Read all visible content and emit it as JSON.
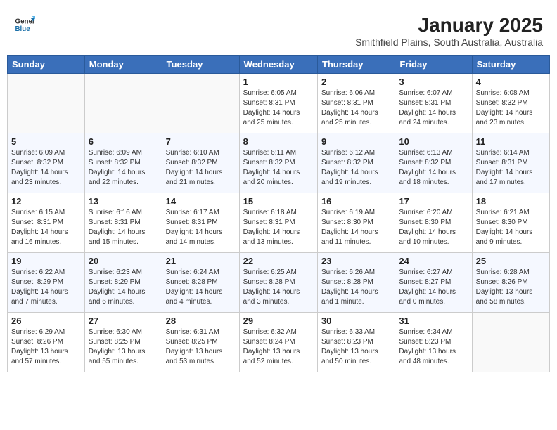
{
  "header": {
    "logo_general": "General",
    "logo_blue": "Blue",
    "title": "January 2025",
    "subtitle": "Smithfield Plains, South Australia, Australia"
  },
  "calendar": {
    "days_of_week": [
      "Sunday",
      "Monday",
      "Tuesday",
      "Wednesday",
      "Thursday",
      "Friday",
      "Saturday"
    ],
    "weeks": [
      [
        {
          "day": "",
          "info": ""
        },
        {
          "day": "",
          "info": ""
        },
        {
          "day": "",
          "info": ""
        },
        {
          "day": "1",
          "info": "Sunrise: 6:05 AM\nSunset: 8:31 PM\nDaylight: 14 hours\nand 25 minutes."
        },
        {
          "day": "2",
          "info": "Sunrise: 6:06 AM\nSunset: 8:31 PM\nDaylight: 14 hours\nand 25 minutes."
        },
        {
          "day": "3",
          "info": "Sunrise: 6:07 AM\nSunset: 8:31 PM\nDaylight: 14 hours\nand 24 minutes."
        },
        {
          "day": "4",
          "info": "Sunrise: 6:08 AM\nSunset: 8:32 PM\nDaylight: 14 hours\nand 23 minutes."
        }
      ],
      [
        {
          "day": "5",
          "info": "Sunrise: 6:09 AM\nSunset: 8:32 PM\nDaylight: 14 hours\nand 23 minutes."
        },
        {
          "day": "6",
          "info": "Sunrise: 6:09 AM\nSunset: 8:32 PM\nDaylight: 14 hours\nand 22 minutes."
        },
        {
          "day": "7",
          "info": "Sunrise: 6:10 AM\nSunset: 8:32 PM\nDaylight: 14 hours\nand 21 minutes."
        },
        {
          "day": "8",
          "info": "Sunrise: 6:11 AM\nSunset: 8:32 PM\nDaylight: 14 hours\nand 20 minutes."
        },
        {
          "day": "9",
          "info": "Sunrise: 6:12 AM\nSunset: 8:32 PM\nDaylight: 14 hours\nand 19 minutes."
        },
        {
          "day": "10",
          "info": "Sunrise: 6:13 AM\nSunset: 8:32 PM\nDaylight: 14 hours\nand 18 minutes."
        },
        {
          "day": "11",
          "info": "Sunrise: 6:14 AM\nSunset: 8:31 PM\nDaylight: 14 hours\nand 17 minutes."
        }
      ],
      [
        {
          "day": "12",
          "info": "Sunrise: 6:15 AM\nSunset: 8:31 PM\nDaylight: 14 hours\nand 16 minutes."
        },
        {
          "day": "13",
          "info": "Sunrise: 6:16 AM\nSunset: 8:31 PM\nDaylight: 14 hours\nand 15 minutes."
        },
        {
          "day": "14",
          "info": "Sunrise: 6:17 AM\nSunset: 8:31 PM\nDaylight: 14 hours\nand 14 minutes."
        },
        {
          "day": "15",
          "info": "Sunrise: 6:18 AM\nSunset: 8:31 PM\nDaylight: 14 hours\nand 13 minutes."
        },
        {
          "day": "16",
          "info": "Sunrise: 6:19 AM\nSunset: 8:30 PM\nDaylight: 14 hours\nand 11 minutes."
        },
        {
          "day": "17",
          "info": "Sunrise: 6:20 AM\nSunset: 8:30 PM\nDaylight: 14 hours\nand 10 minutes."
        },
        {
          "day": "18",
          "info": "Sunrise: 6:21 AM\nSunset: 8:30 PM\nDaylight: 14 hours\nand 9 minutes."
        }
      ],
      [
        {
          "day": "19",
          "info": "Sunrise: 6:22 AM\nSunset: 8:29 PM\nDaylight: 14 hours\nand 7 minutes."
        },
        {
          "day": "20",
          "info": "Sunrise: 6:23 AM\nSunset: 8:29 PM\nDaylight: 14 hours\nand 6 minutes."
        },
        {
          "day": "21",
          "info": "Sunrise: 6:24 AM\nSunset: 8:28 PM\nDaylight: 14 hours\nand 4 minutes."
        },
        {
          "day": "22",
          "info": "Sunrise: 6:25 AM\nSunset: 8:28 PM\nDaylight: 14 hours\nand 3 minutes."
        },
        {
          "day": "23",
          "info": "Sunrise: 6:26 AM\nSunset: 8:28 PM\nDaylight: 14 hours\nand 1 minute."
        },
        {
          "day": "24",
          "info": "Sunrise: 6:27 AM\nSunset: 8:27 PM\nDaylight: 14 hours\nand 0 minutes."
        },
        {
          "day": "25",
          "info": "Sunrise: 6:28 AM\nSunset: 8:26 PM\nDaylight: 13 hours\nand 58 minutes."
        }
      ],
      [
        {
          "day": "26",
          "info": "Sunrise: 6:29 AM\nSunset: 8:26 PM\nDaylight: 13 hours\nand 57 minutes."
        },
        {
          "day": "27",
          "info": "Sunrise: 6:30 AM\nSunset: 8:25 PM\nDaylight: 13 hours\nand 55 minutes."
        },
        {
          "day": "28",
          "info": "Sunrise: 6:31 AM\nSunset: 8:25 PM\nDaylight: 13 hours\nand 53 minutes."
        },
        {
          "day": "29",
          "info": "Sunrise: 6:32 AM\nSunset: 8:24 PM\nDaylight: 13 hours\nand 52 minutes."
        },
        {
          "day": "30",
          "info": "Sunrise: 6:33 AM\nSunset: 8:23 PM\nDaylight: 13 hours\nand 50 minutes."
        },
        {
          "day": "31",
          "info": "Sunrise: 6:34 AM\nSunset: 8:23 PM\nDaylight: 13 hours\nand 48 minutes."
        },
        {
          "day": "",
          "info": ""
        }
      ]
    ]
  }
}
